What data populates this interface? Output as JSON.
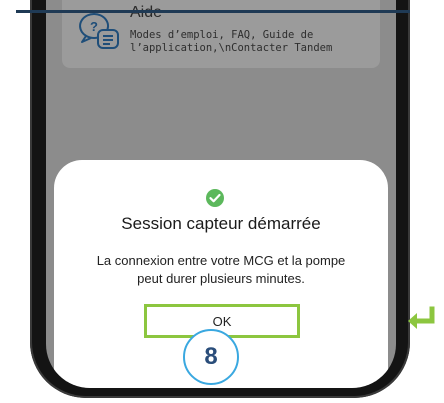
{
  "help": {
    "title": "Aide",
    "description": "Modes d’emploi, FAQ, Guide de l’application,\\nContacter Tandem",
    "icon": "help-chat-icon"
  },
  "modal": {
    "icon": "check-circle-icon",
    "title": "Session capteur démarrée",
    "message": "La connexion entre votre MCG et la pompe peut durer plusieurs minutes.",
    "ok_label": "OK"
  },
  "step": {
    "number": "8"
  },
  "colors": {
    "accent_green": "#8cc63f",
    "check_green": "#5cb85c",
    "badge_blue": "#3aa8e0",
    "header_navy": "#1f3a55"
  },
  "hint_icon": "enter-return-icon"
}
